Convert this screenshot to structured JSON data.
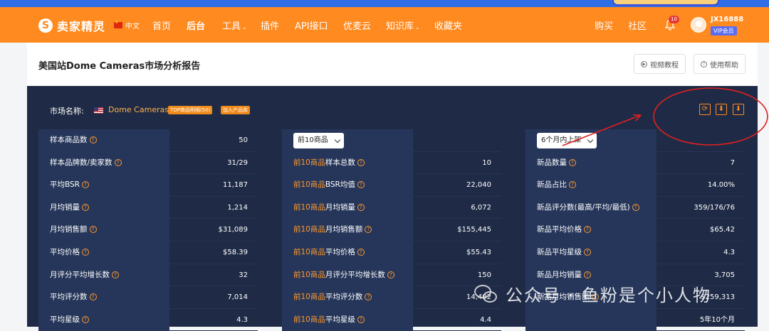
{
  "navbar": {
    "logo": "卖家精灵",
    "lang": "中文",
    "items": [
      {
        "label": "首页",
        "caret": false
      },
      {
        "label": "后台",
        "caret": false
      },
      {
        "label": "工具",
        "caret": true
      },
      {
        "label": "插件",
        "caret": false
      },
      {
        "label": "API接口",
        "caret": false
      },
      {
        "label": "优麦云",
        "caret": false
      },
      {
        "label": "知识库",
        "caret": true
      },
      {
        "label": "收藏夹",
        "caret": false
      }
    ],
    "right_items": [
      "购买",
      "社区"
    ],
    "notification_count": "10",
    "user_name": "JX16888",
    "vip_label": "VIP会员"
  },
  "page": {
    "title": "美国站Dome Cameras市场分析报告",
    "video_button": "视频教程",
    "help_button": "使用帮助"
  },
  "market": {
    "label": "市场名称:",
    "name": "Dome Cameras",
    "tag_top": "TOP商品明细(50)",
    "tag_add": "加入产品库"
  },
  "columns": [
    {
      "select": null,
      "rows": [
        {
          "label": "样本商品数",
          "value": "50"
        },
        {
          "label": "样本品牌数/卖家数",
          "value": "31/29"
        },
        {
          "label": "平均BSR",
          "value": "11,187"
        },
        {
          "label": "月均销量",
          "value": "1,214"
        },
        {
          "label": "月均销售额",
          "value": "$31,089"
        },
        {
          "label": "平均价格",
          "value": "$58.39"
        },
        {
          "label": "月评分平均增长数",
          "value": "32"
        },
        {
          "label": "平均评分数",
          "value": "7,014"
        },
        {
          "label": "平均星级",
          "value": "4.3"
        }
      ]
    },
    {
      "select": "前10商品",
      "highlight": "前10商品",
      "rows": [
        {
          "label": "样本总数",
          "value": "10"
        },
        {
          "label": "BSR均值",
          "value": "22,040"
        },
        {
          "label": "月均销量",
          "value": "6,072"
        },
        {
          "label": "月均销售额",
          "value": "$155,445"
        },
        {
          "label": "平均价格",
          "value": "$55.43"
        },
        {
          "label": "月评分平均增长数",
          "value": "150"
        },
        {
          "label": "平均评分数",
          "value": "14,492"
        },
        {
          "label": "平均星级",
          "value": "4.4"
        }
      ]
    },
    {
      "select": "6个月内上架",
      "rows": [
        {
          "label": "新品数量",
          "value": "7"
        },
        {
          "label": "新品占比",
          "value": "14.00%"
        },
        {
          "label": "新品评分数(最高/平均/最低)",
          "value": "359/176/76"
        },
        {
          "label": "新品平均价格",
          "value": "$65.42"
        },
        {
          "label": "新品平均星级",
          "value": "4.3"
        },
        {
          "label": "新品月均销量",
          "value": "3,705"
        },
        {
          "label": "新品月均销售额",
          "value": "$259,313"
        },
        {
          "label": "",
          "value": "5年10个月"
        }
      ]
    }
  ],
  "watermark": "公众号 · 鱼粉是个小人物",
  "colors": {
    "brand": "#ff8a1f",
    "panel": "#1f2b46",
    "annotation": "#e02020"
  }
}
